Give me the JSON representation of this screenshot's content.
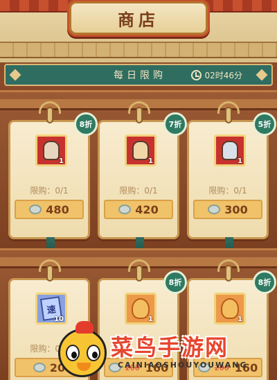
{
  "header": {
    "title": "商店"
  },
  "daily": {
    "title": "每日限购",
    "timer": "02时46分"
  },
  "row1": [
    {
      "discount": "8折",
      "count": "1",
      "limit": "限购：0/1",
      "price": "480",
      "item": "hero-portrait-icon"
    },
    {
      "discount": "7折",
      "count": "1",
      "limit": "限购：0/1",
      "price": "420",
      "item": "hero-portrait-icon"
    },
    {
      "discount": "5折",
      "count": "1",
      "limit": "限购：0/1",
      "price": "300",
      "item": "hero-portrait-icon"
    }
  ],
  "row2": [
    {
      "count": "10",
      "limit": "限购：0/5",
      "price": "20",
      "scroll_glyph": "速",
      "item": "speed-scroll-icon"
    },
    {
      "discount": "8折",
      "count": "1",
      "old_price": "200",
      "price": "160",
      "item": "flame-fragment-icon"
    },
    {
      "discount": "8折",
      "count": "1",
      "old_price": "200",
      "price": "160",
      "item": "flame-fragment-icon"
    }
  ],
  "watermark": {
    "text": "菜鸟手游网",
    "sub": "CAINIAOSHOUYOUWANG"
  },
  "colors": {
    "accent_green": "#2f6d61",
    "wood": "#8a4a2a",
    "price_gold": "#f0c26a"
  }
}
